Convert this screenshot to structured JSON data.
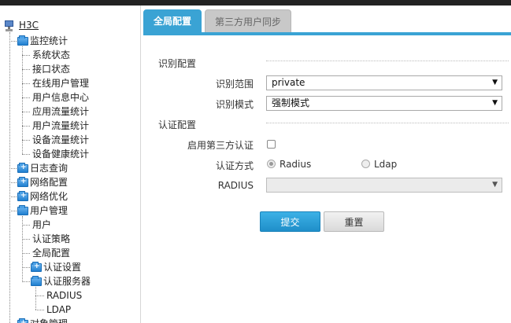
{
  "sidebar": {
    "root": "H3C",
    "monitor": {
      "label": "监控统计",
      "items": [
        "系统状态",
        "接口状态",
        "在线用户管理",
        "用户信息中心",
        "应用流量统计",
        "用户流量统计",
        "设备流量统计",
        "设备健康统计"
      ]
    },
    "log_query": "日志查询",
    "network_config": "网络配置",
    "network_optimize": "网络优化",
    "user_management": {
      "label": "用户管理",
      "items": [
        "用户",
        "认证策略",
        "全局配置"
      ],
      "auth_settings": "认证设置",
      "auth_servers": {
        "label": "认证服务器",
        "items": [
          "RADIUS",
          "LDAP"
        ]
      }
    },
    "cut_off_item": "对象管理"
  },
  "tabs": {
    "global_config": "全局配置",
    "third_party_sync": "第三方用户同步"
  },
  "form": {
    "identify_section": "识别配置",
    "identify_scope_label": "识别范围",
    "identify_scope_value": "private",
    "identify_mode_label": "识别模式",
    "identify_mode_value": "强制模式",
    "auth_section": "认证配置",
    "third_party_auth_label": "启用第三方认证",
    "auth_method_label": "认证方式",
    "auth_method_radius": "Radius",
    "auth_method_ldap": "Ldap",
    "radius_label": "RADIUS",
    "radius_value": ""
  },
  "buttons": {
    "submit": "提交",
    "reset": "重置"
  },
  "colors": {
    "accent": "#3aa3d4",
    "tab_inactive": "#c8c8c8",
    "folder_blue": "#1f7fd0"
  },
  "icons": {
    "dropdown": "▼",
    "expand": "+",
    "collapse": "−"
  }
}
